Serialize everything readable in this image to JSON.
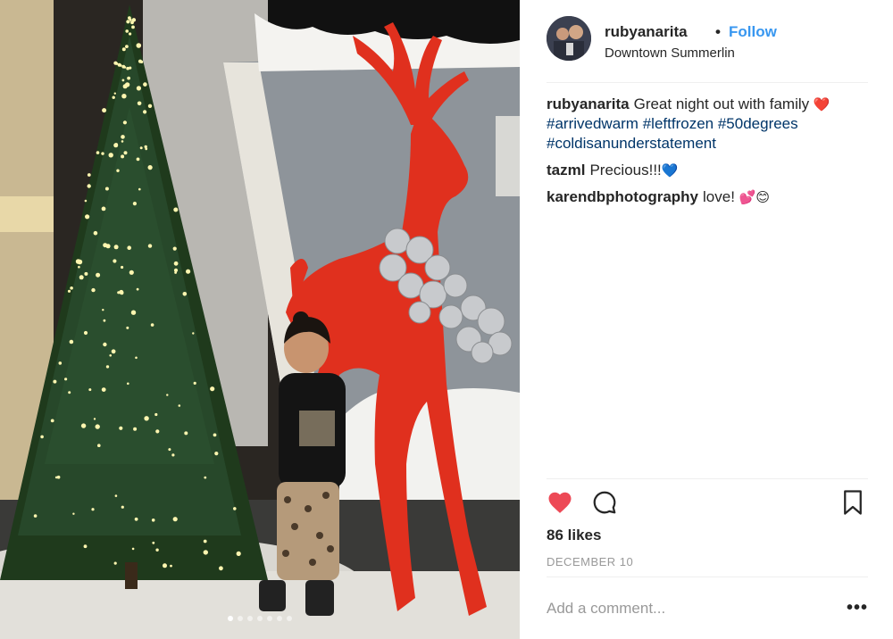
{
  "post": {
    "username": "rubyanarita",
    "separator": "•",
    "follow_label": "Follow",
    "location": "Downtown Summerlin"
  },
  "comments": [
    {
      "user": "rubyanarita",
      "text": "Great night out with family",
      "emoji": "❤️",
      "hashtags": [
        "#arrivedwarm",
        "#leftfrozen",
        "#50degrees",
        "#coldisanunderstatement"
      ]
    },
    {
      "user": "tazml",
      "text": "Precious!!!",
      "emoji": "💙"
    },
    {
      "user": "karendbphotography",
      "text": "love!",
      "emoji": "💕😊"
    }
  ],
  "actions": {
    "like_icon": "heart-filled-icon",
    "comment_icon": "speech-bubble-icon",
    "save_icon": "bookmark-icon",
    "like_color": "#ed4956"
  },
  "likes_text": "86 likes",
  "date_text": "DECEMBER 10",
  "add_comment_placeholder": "Add a comment...",
  "more_label": "•••",
  "carousel": {
    "total": 7,
    "active_index": 0
  }
}
